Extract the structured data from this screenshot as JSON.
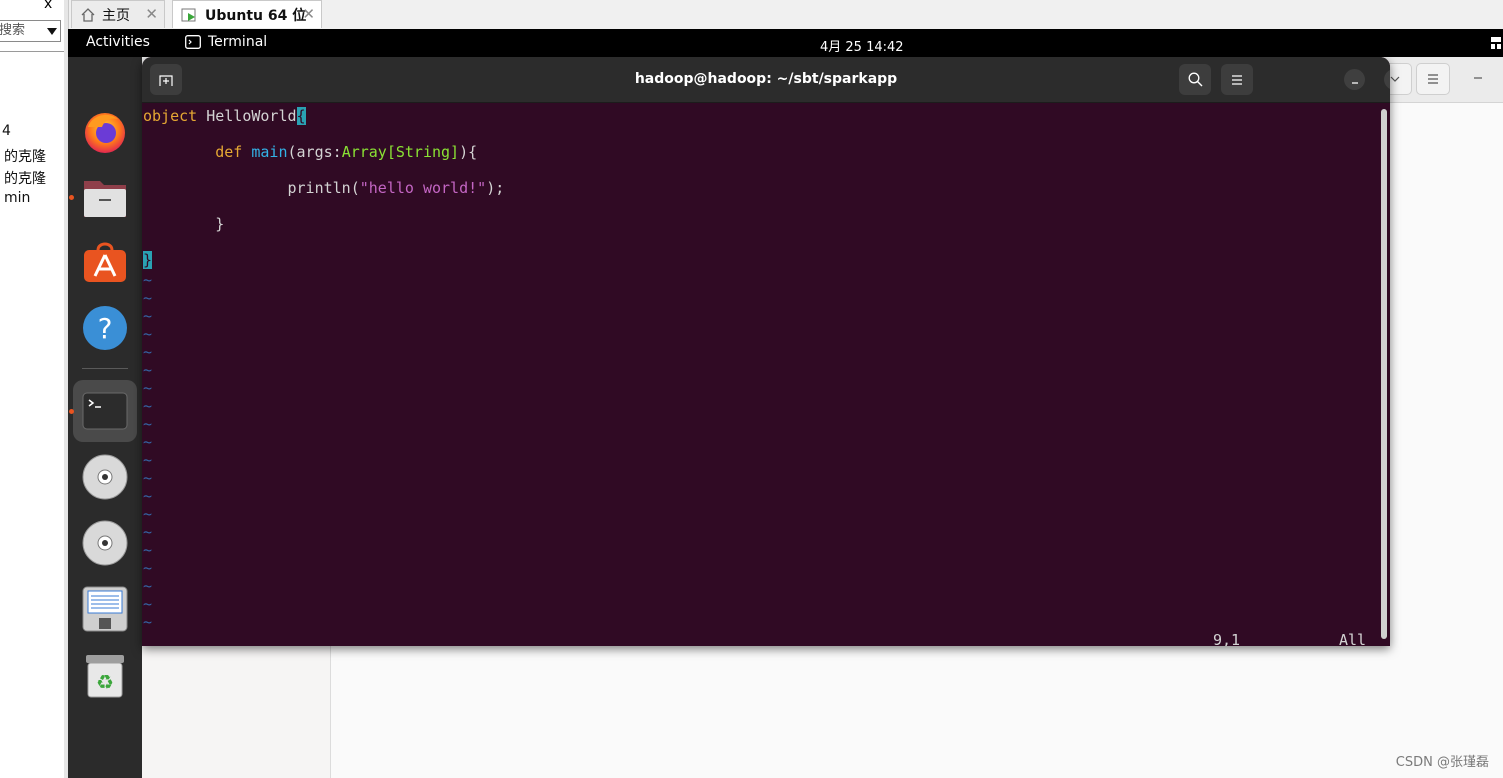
{
  "library": {
    "close_label": "x",
    "search_placeholder": "搜索",
    "items": [
      "4",
      "的克隆",
      "的克隆",
      "min"
    ]
  },
  "tabs": [
    {
      "label": "主页",
      "icon": "home-icon"
    },
    {
      "label": "Ubuntu 64 位",
      "icon": "vm-play-icon",
      "active": true
    }
  ],
  "topbar": {
    "activities": "Activities",
    "app_name": "Terminal",
    "clock": "4月 25  14:42"
  },
  "dock": {
    "items": [
      {
        "name": "firefox-icon",
        "running": false
      },
      {
        "name": "files-icon",
        "running": true
      },
      {
        "name": "app-center-icon",
        "running": false
      },
      {
        "name": "help-icon",
        "running": false
      },
      {
        "name": "terminal-icon",
        "running": true,
        "active": true
      },
      {
        "name": "cdrom-icon",
        "running": false
      },
      {
        "name": "cdrom-icon",
        "running": false
      },
      {
        "name": "disk-image-icon",
        "running": false
      },
      {
        "name": "trash-icon",
        "running": false
      }
    ]
  },
  "terminal": {
    "title": "hadoop@hadoop: ~/sbt/sparkapp",
    "code": {
      "l1_kw": "object",
      "l1_name": " HelloWorld",
      "l1_brace": "{",
      "l2_indent": "        ",
      "l2_kw": "def",
      "l2_fn": " main",
      "l2_a": "(args:",
      "l2_type": "Array[String]",
      "l2_b": "){",
      "l3_indent": "                ",
      "l3_a": "println(",
      "l3_str": "\"hello world!\"",
      "l3_b": ");",
      "l4": "        }",
      "l5": "}"
    },
    "tilde": "~",
    "status_pos": "9,1",
    "status_all": "All"
  },
  "watermark": "CSDN @张瑾磊",
  "colors": {
    "terminal_bg": "#300a24",
    "keyword": "#e5a833",
    "function": "#33b2e6",
    "type": "#8ae234",
    "string": "#c466c4",
    "cursor": "#2aa1b3",
    "tilde": "#3465a4",
    "accent": "#e95420"
  }
}
